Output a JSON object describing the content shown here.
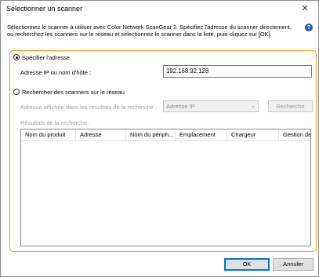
{
  "window": {
    "title": "Sélectionner un scanner",
    "close_glyph": "✕"
  },
  "instructions": "Sélectionnez le scanner à utiliser avec Color Network ScanGear 2. Spécifiez l'adresse du scanner directement, ou recherchez les scanners sur le réseau et sélectionnez le scanner dans la liste, puis cliquez sur [OK].",
  "help_icon": {
    "glyph": "?",
    "icon": "help-icon"
  },
  "specify": {
    "radio_label": "Spécifier l'adresse",
    "selected": true,
    "field_label": "Adresse IP ou nom d'hôte :",
    "field_value": "192.168.92.128"
  },
  "search": {
    "radio_label": "Rechercher des scanners sur le réseau",
    "selected": false,
    "display_label": "Adresse affichée dans les résultats de la recherche :",
    "display_value": "Adresse IP",
    "search_button": "Recherche",
    "results_label": "Résultats de la recherche :",
    "columns": [
      "Nom du produit",
      "Adresse",
      "Nom du périph...",
      "Emplacement",
      "Chargeur",
      "Gestion de"
    ]
  },
  "footer": {
    "ok": "OK",
    "cancel": "Annuler"
  },
  "colors": {
    "group_border": "#f0a020",
    "help_icon": "#1e5fb4",
    "default_button_border": "#0078d7"
  }
}
